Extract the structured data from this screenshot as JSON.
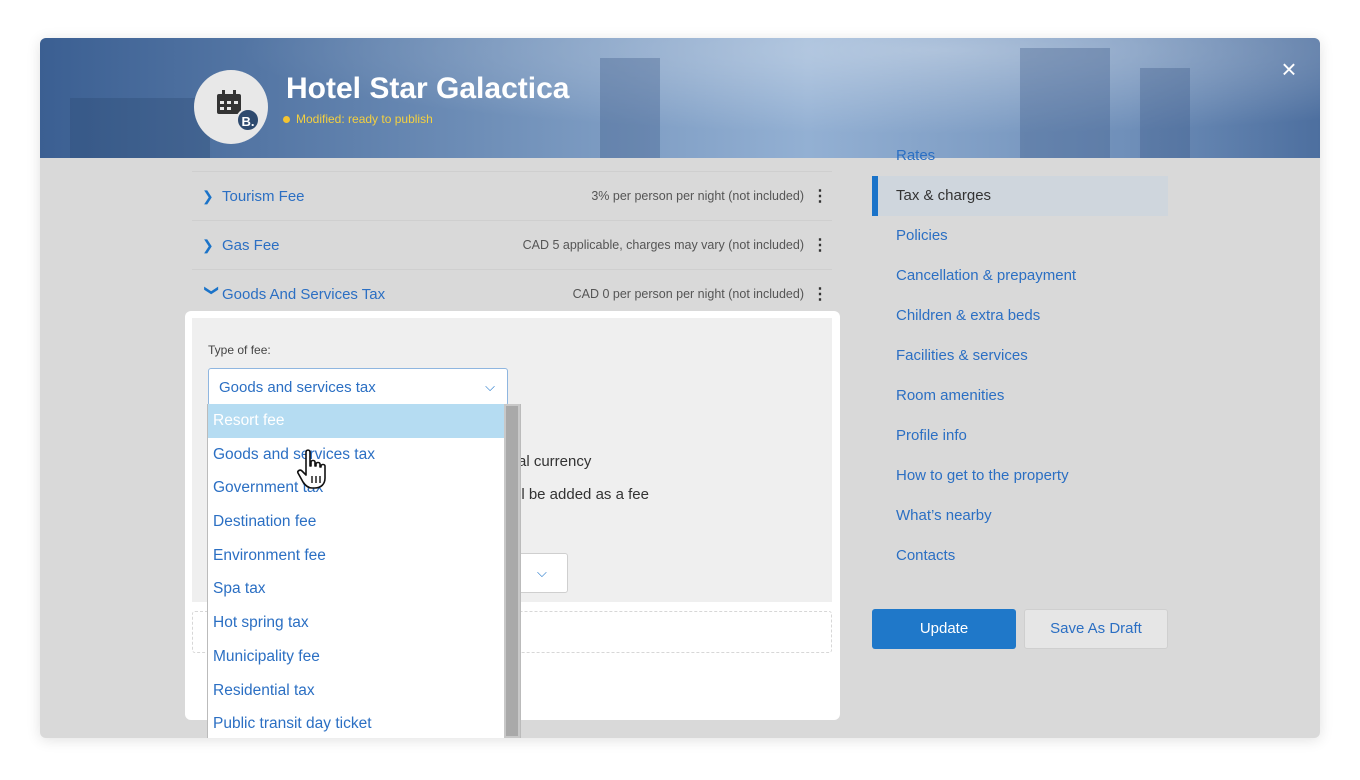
{
  "header": {
    "title": "Hotel Star Galactica",
    "status": "Modified: ready to publish",
    "logo_letter": "B.",
    "close_glyph": "×",
    "status_color": "#f4c430",
    "icons": {
      "logo": "calendar-icon",
      "close": "close-icon"
    }
  },
  "fees": [
    {
      "name": "Tourism Fee",
      "description": "3% per person per night (not included)",
      "expanded": false
    },
    {
      "name": "Gas Fee",
      "description": "CAD 5 applicable, charges may vary (not included)",
      "expanded": false
    },
    {
      "name": "Goods And Services Tax",
      "description": "CAD 0 per person per night (not included)",
      "expanded": true
    }
  ],
  "fee_form": {
    "type_label": "Type of fee:",
    "type_value": "Goods and services tax",
    "partial_text_1": "al currency",
    "partial_text_2": "ll be added as a fee"
  },
  "dropdown": {
    "options": [
      "Resort fee",
      "Goods and services tax",
      "Government tax",
      "Destination fee",
      "Environment fee",
      "Spa tax",
      "Hot spring tax",
      "Municipality fee",
      "Residential tax",
      "Public transit day ticket"
    ],
    "highlighted": "Resort fee"
  },
  "nav": {
    "items": [
      "Rates",
      "Tax & charges",
      "Policies",
      "Cancellation & prepayment",
      "Children & extra beds",
      "Facilities & services",
      "Room amenities",
      "Profile info",
      "How to get to the property",
      "What’s nearby",
      "Contacts"
    ],
    "active": "Tax & charges"
  },
  "actions": {
    "update_label": "Update",
    "draft_label": "Save As Draft"
  },
  "colors": {
    "accent": "#1f78c9",
    "link": "#2b6fc3",
    "highlight": "#b5dcf2"
  }
}
